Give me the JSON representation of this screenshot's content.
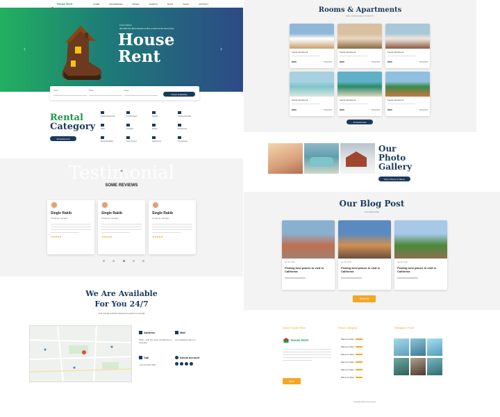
{
  "brand": {
    "name": "House Rent",
    "color": "#1c9a4a"
  },
  "nav": [
    "HOME",
    "PROPERTIES",
    "PAGES",
    "AGENTS",
    "BLOG",
    "SHOP",
    "CONTACT"
  ],
  "hero": {
    "eyebrow": "Lorem ipsum",
    "tagline": "We Offer the Best Houses to Buy or Rent at the best prices",
    "title_line1": "House",
    "title_line2": "Rent"
  },
  "search": {
    "fields": [
      {
        "label": "Type"
      },
      {
        "label": "Price"
      },
      {
        "label": "Area"
      }
    ],
    "button": "Check availability"
  },
  "rental": {
    "title_line1": "Rental",
    "title_line2": "Category",
    "button": "All Apartments",
    "items": [
      "Family Apartments",
      "Condominium",
      "Resorts",
      "Vacation Rentals",
      "Villas",
      "Cottages",
      "Duplex",
      "Penthouses",
      "Bed & Breakfast",
      "Farm Houses",
      "Apartments",
      "Townhouses"
    ]
  },
  "rooms": {
    "title": "Rooms & Apartments",
    "subtitle": "FIND YOUR HOUSE IN YOUR CITY",
    "button": "All Apartments",
    "cards": [
      {
        "title": "Family Apartment",
        "price": "$999"
      },
      {
        "title": "Family Apartment",
        "price": "$999"
      },
      {
        "title": "Family Apartment",
        "price": "$999"
      },
      {
        "title": "Family Apartment",
        "price": "$999"
      },
      {
        "title": "Family Apartment",
        "price": "$999"
      },
      {
        "title": "Family Apartment",
        "price": "$999"
      }
    ]
  },
  "gallery": {
    "title_line1": "Our",
    "title_line2": "Photo",
    "title_line3": "Gallery",
    "button": "More Photos & Videos"
  },
  "testimonial": {
    "bg_word": "Testimonial",
    "quote_mark": "”",
    "heading": "SOME REVIEWS",
    "cards": [
      {
        "name": "Single Rakib",
        "role": "Outgoing manager"
      },
      {
        "name": "Single Rakib",
        "role": "Outgoing manager"
      },
      {
        "name": "Single Rakib",
        "role": "Outgoing manager"
      }
    ],
    "rating": "★★★★★"
  },
  "blog": {
    "title": "Our Blog Post",
    "subtitle": "OUR NEWS FEED",
    "button": "Show All",
    "posts": [
      {
        "meta": "Jan 28, 2019",
        "title": "Finding best places to visit in California"
      },
      {
        "meta": "Jan 28, 2019",
        "title": "Finding best places to visit in California"
      },
      {
        "meta": "Jan 28, 2019",
        "title": "Finding best places to visit in California"
      }
    ]
  },
  "available": {
    "title_line1": "We Are Available",
    "title_line2": "For You 24/7",
    "subtitle": "OUR ONLINE SUPPORT SERVICE IS ALWAYS 24 HOURS",
    "address_label": "Address",
    "address_text": "2800 - 17th Rd, Suite 33 Melbourne Australia",
    "call_label": "Call",
    "call_text": "+00 123 456 7890",
    "mail_label": "Mail",
    "mail_text": "yourmail@domain.com",
    "social_label": "Social account"
  },
  "footer": {
    "col1_title": "About House Rent",
    "col2_title": "Place Category",
    "col3_title": "Instagram Feed",
    "brand": "House Rent",
    "more_button": "More",
    "links": [
      "Place for Rent",
      "Place for Rent",
      "Place for Rent",
      "Place for Rent",
      "Place for Rent",
      "Place for Rent"
    ],
    "copyright": "Copyright 2019 | House Rent"
  },
  "colors": {
    "navy": "#1a3a5c",
    "green": "#1c9a4a",
    "orange": "#f5a623"
  }
}
